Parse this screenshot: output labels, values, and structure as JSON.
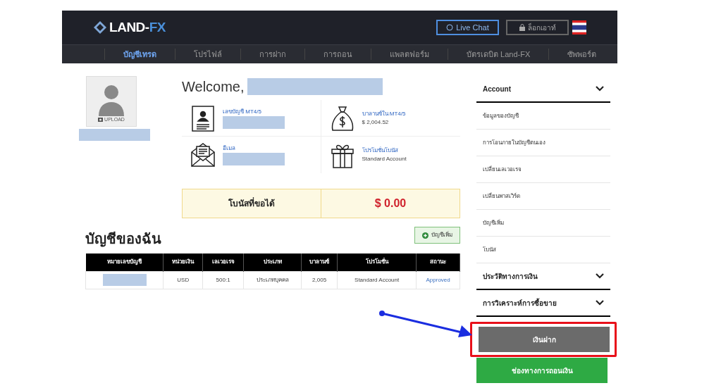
{
  "header": {
    "logo": "LAND-",
    "logo_accent": "FX",
    "live_chat": "Live Chat",
    "logout": "ล็อกเอาท์"
  },
  "nav": [
    {
      "label": "บัญชีเทรด",
      "selected": true
    },
    {
      "label": "โปรไฟล์",
      "selected": false
    },
    {
      "label": "การฝาก",
      "selected": false
    },
    {
      "label": "การถอน",
      "selected": false
    },
    {
      "label": "แพลตฟอร์ม",
      "selected": false
    },
    {
      "label": "บัตรเดบิต Land-FX",
      "selected": false
    },
    {
      "label": "ซัพพอร์ต",
      "selected": false
    }
  ],
  "profile": {
    "upload": "UPLOAD"
  },
  "welcome": "Welcome,",
  "info": [
    {
      "kind": "account",
      "label": "เลขบัญชี MT4/5"
    },
    {
      "kind": "balance",
      "label": "บาลานซ์ใน MT4/5",
      "value": "$ 2,004.52"
    },
    {
      "kind": "email",
      "label": "อีเมล"
    },
    {
      "kind": "promo",
      "label": "โปรโมชั่นโบนัส",
      "value": "Standard Account"
    }
  ],
  "bonus": {
    "label": "โบนัสที่ขอได้",
    "value": "$ 0.00"
  },
  "accounts": {
    "title": "บัญชีของฉัน",
    "add_button": "บัญชีเพิ่ม",
    "columns": [
      "หมายเลขบัญชี",
      "หน่วยเงิน",
      "เลเวอเรจ",
      "ประเภท",
      "บาลานซ์",
      "โปรโมชั่น",
      "สถานะ"
    ],
    "rows": [
      {
        "currency": "USD",
        "leverage": "500:1",
        "type": "ประเภทบุคคล",
        "balance": "2,005",
        "promotion": "Standard Account",
        "status": "Approved"
      }
    ]
  },
  "sidebar": [
    {
      "title": "Account",
      "items": [
        "ข้อมูลของบัญชี",
        "การโอนภายในบัญชีตนเอง",
        "เปลี่ยนเลเวอเรจ",
        "เปลี่ยนพาสเวิร์ด",
        "บัญชีเพิ่ม",
        "โบนัส"
      ]
    },
    {
      "title": "ประวัติทางการเงิน"
    },
    {
      "title": "การวิเคราะห์การซื้อขาย"
    }
  ],
  "actions": [
    {
      "kind": "deposit",
      "label": "เงินฝาก",
      "highlighted": true
    },
    {
      "kind": "withdraw",
      "label": "ช่องทางการถอนเงิน",
      "highlighted": false
    }
  ]
}
